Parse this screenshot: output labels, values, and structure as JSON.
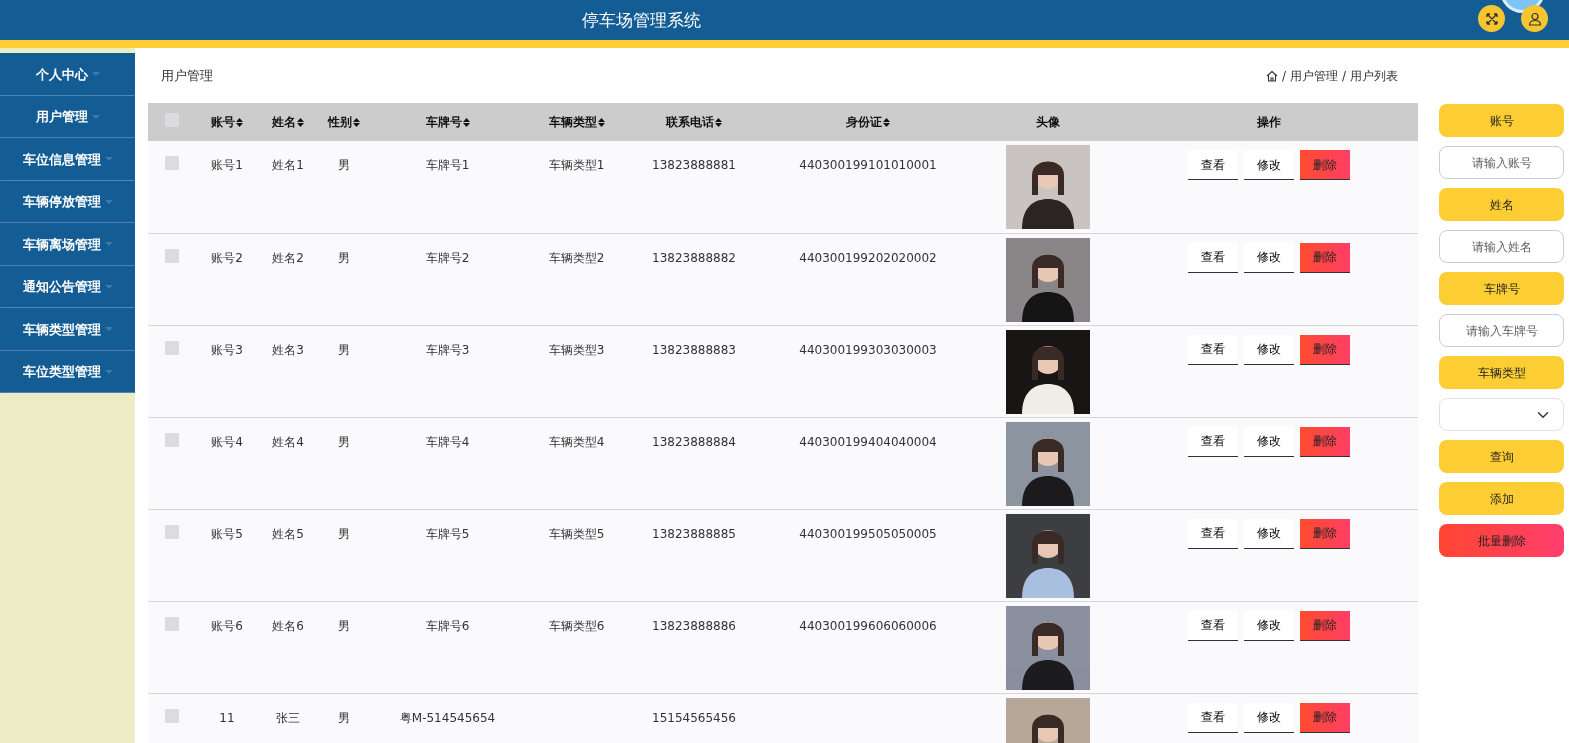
{
  "header": {
    "title": "停车场管理系统"
  },
  "sidebar": {
    "items": [
      {
        "label": "个人中心",
        "expanded": false
      },
      {
        "label": "用户管理",
        "expanded": false
      },
      {
        "label": "车位信息管理",
        "expanded": false
      },
      {
        "label": "车辆停放管理",
        "expanded": false
      },
      {
        "label": "车辆离场管理",
        "expanded": false
      },
      {
        "label": "通知公告管理",
        "expanded": false
      },
      {
        "label": "车辆类型管理",
        "expanded": false
      },
      {
        "label": "车位类型管理",
        "expanded": false
      }
    ]
  },
  "page_title": "用户管理",
  "breadcrumb": [
    {
      "separator": "/",
      "label": "用户管理"
    },
    {
      "separator": "/",
      "label": "用户列表"
    }
  ],
  "table": {
    "select_all": {
      "checked": false
    },
    "columns": [
      {
        "label": "账号",
        "sortable": true
      },
      {
        "label": "姓名",
        "sortable": true
      },
      {
        "label": "性别",
        "sortable": true
      },
      {
        "label": "车牌号",
        "sortable": true
      },
      {
        "label": "车辆类型",
        "sortable": true
      },
      {
        "label": "联系电话",
        "sortable": true
      },
      {
        "label": "身份证",
        "sortable": true
      },
      {
        "label": "头像",
        "sortable": false
      },
      {
        "label": "操作",
        "sortable": false
      }
    ],
    "rows": [
      {
        "checked": false,
        "cells": [
          "账号1",
          "姓名1",
          "男",
          "车牌号1",
          "车辆类型1",
          "13823888881",
          "440300199101010001"
        ],
        "actions": [
          {
            "label": "查看",
            "kind": "plain"
          },
          {
            "label": "修改",
            "kind": "plain"
          },
          {
            "label": "删除",
            "kind": "danger"
          }
        ]
      },
      {
        "checked": false,
        "cells": [
          "账号2",
          "姓名2",
          "男",
          "车牌号2",
          "车辆类型2",
          "13823888882",
          "440300199202020002"
        ],
        "actions": [
          {
            "label": "查看",
            "kind": "plain"
          },
          {
            "label": "修改",
            "kind": "plain"
          },
          {
            "label": "删除",
            "kind": "danger"
          }
        ]
      },
      {
        "checked": false,
        "cells": [
          "账号3",
          "姓名3",
          "男",
          "车牌号3",
          "车辆类型3",
          "13823888883",
          "440300199303030003"
        ],
        "actions": [
          {
            "label": "查看",
            "kind": "plain"
          },
          {
            "label": "修改",
            "kind": "plain"
          },
          {
            "label": "删除",
            "kind": "danger"
          }
        ]
      },
      {
        "checked": false,
        "cells": [
          "账号4",
          "姓名4",
          "男",
          "车牌号4",
          "车辆类型4",
          "13823888884",
          "440300199404040004"
        ],
        "actions": [
          {
            "label": "查看",
            "kind": "plain"
          },
          {
            "label": "修改",
            "kind": "plain"
          },
          {
            "label": "删除",
            "kind": "danger"
          }
        ]
      },
      {
        "checked": false,
        "cells": [
          "账号5",
          "姓名5",
          "男",
          "车牌号5",
          "车辆类型5",
          "13823888885",
          "440300199505050005"
        ],
        "actions": [
          {
            "label": "查看",
            "kind": "plain"
          },
          {
            "label": "修改",
            "kind": "plain"
          },
          {
            "label": "删除",
            "kind": "danger"
          }
        ]
      },
      {
        "checked": false,
        "cells": [
          "账号6",
          "姓名6",
          "男",
          "车牌号6",
          "车辆类型6",
          "13823888886",
          "440300199606060006"
        ],
        "actions": [
          {
            "label": "查看",
            "kind": "plain"
          },
          {
            "label": "修改",
            "kind": "plain"
          },
          {
            "label": "删除",
            "kind": "danger"
          }
        ]
      },
      {
        "checked": false,
        "cells": [
          "11",
          "张三",
          "男",
          "粤M-514545654",
          "",
          "15154565456",
          ""
        ],
        "actions": [
          {
            "label": "查看",
            "kind": "plain"
          },
          {
            "label": "修改",
            "kind": "plain"
          },
          {
            "label": "删除",
            "kind": "danger"
          }
        ]
      }
    ]
  },
  "search": {
    "items": [
      {
        "kind": "label",
        "text": "账号"
      },
      {
        "kind": "input",
        "placeholder": "请输入账号"
      },
      {
        "kind": "label",
        "text": "姓名"
      },
      {
        "kind": "input",
        "placeholder": "请输入姓名"
      },
      {
        "kind": "label",
        "text": "车牌号"
      },
      {
        "kind": "input",
        "placeholder": "请输入车牌号"
      },
      {
        "kind": "label",
        "text": "车辆类型"
      },
      {
        "kind": "select"
      },
      {
        "kind": "button",
        "text": "查询"
      },
      {
        "kind": "button",
        "text": "添加"
      },
      {
        "kind": "danger",
        "text": "批量删除"
      }
    ]
  }
}
